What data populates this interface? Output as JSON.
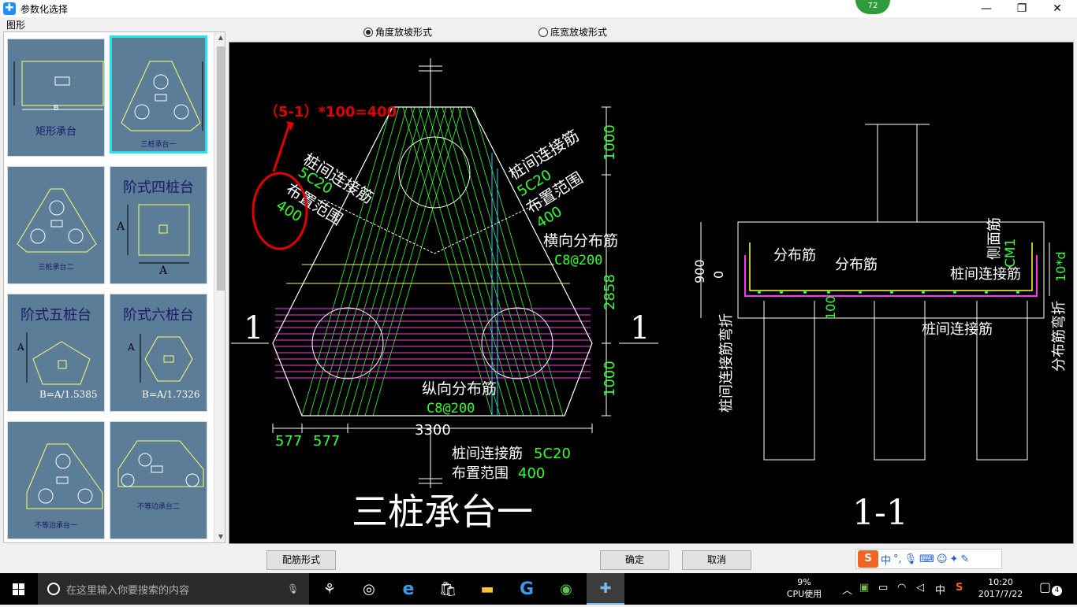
{
  "window": {
    "title": "参数化选择",
    "minimize": "—",
    "maximize": "❐",
    "close": "✕",
    "badge": "72"
  },
  "left_panel": {
    "label": "图形",
    "thumbs": [
      {
        "caption": "矩形承台",
        "dim": "B"
      },
      {
        "caption": "三桩承台一"
      },
      {
        "caption": "三桩承台二"
      },
      {
        "caption": "阶式四桩台",
        "dim_a": "A",
        "dim_b": "A"
      },
      {
        "caption": "阶式五桩台",
        "formula": "B=A/1.5385",
        "dim_a": "A"
      },
      {
        "caption": "阶式六桩台",
        "formula": "B=A/1.7326",
        "dim_a": "A"
      },
      {
        "caption": "不等边承台一"
      },
      {
        "caption": "不等边承台二"
      }
    ]
  },
  "radios": [
    {
      "label": "角度放坡形式",
      "selected": true
    },
    {
      "label": "底宽放坡形式",
      "selected": false
    }
  ],
  "drawing": {
    "formula": "（5-1）*100=400",
    "circled_text": "400",
    "plan_labels": {
      "left_conn": "桩间连接筋",
      "left_conn_spec": "5C20",
      "left_range": "布置范围",
      "right_conn": "桩间连接筋",
      "right_conn_spec": "5C20",
      "right_range": "布置范围",
      "right_range_val": "400",
      "horiz_dist": "横向分布筋",
      "horiz_spec": "C8@200",
      "long_dist": "纵向分布筋",
      "long_spec": "C8@200",
      "bottom_conn": "桩间连接筋",
      "bottom_conn_spec": "5C20",
      "bottom_range": "布置范围",
      "bottom_range_val": "400",
      "section_mark": "1",
      "dim_top": "1000",
      "dim_mid": "2858",
      "dim_bot": "1000",
      "dim_width": "3300",
      "dim_577a": "577",
      "dim_577b": "577",
      "title": "三桩承台一"
    },
    "section_labels": {
      "dist1": "分布筋",
      "dist2": "分布筋",
      "side": "侧面筋",
      "side_spec": "CM1",
      "conn": "桩间连接筋",
      "conn2": "桩间连接筋",
      "left_bend": "桩间连接筋弯折",
      "right_bend": "分布筋弯折",
      "dim_900": "900",
      "dim_0": "0",
      "dim_100": "100",
      "dim_10d": "10*d",
      "title": "1-1"
    }
  },
  "buttons": {
    "rebar_form": "配筋形式",
    "ok": "确定",
    "cancel": "取消"
  },
  "ime": {
    "logo": "S",
    "mode": "中",
    "punct": "°,"
  },
  "taskbar": {
    "search_placeholder": "在这里输入你要搜索的内容",
    "cpu_pct": "9%",
    "cpu_label": "CPU使用",
    "lang": "中",
    "time": "10:20",
    "date": "2017/7/22",
    "notif_count": "4"
  },
  "colors": {
    "drawing_bg": "#000000",
    "white": "#ffffff",
    "green": "#33ff33",
    "yellow": "#ffff33",
    "magenta": "#ff33ff",
    "cyan": "#33ccff",
    "annotation_red": "#e00000",
    "thumb_bg": "#5b7d98",
    "thumb_selected_border": "#24e3ee"
  }
}
